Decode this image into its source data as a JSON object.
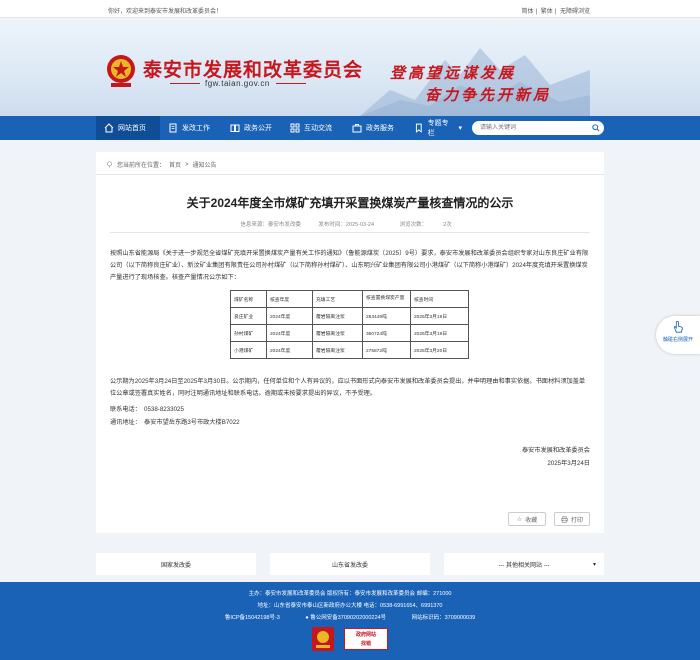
{
  "topbar": {
    "welcome": "你好，欢迎来到泰安市发展和改革委员会！",
    "links": [
      "简体",
      "繁体",
      "无障碍浏览"
    ]
  },
  "banner": {
    "title": "泰安市发展和改革委员会",
    "url": "fgw.taian.gov.cn",
    "slogan1": "登高望远谋发展",
    "slogan2": "奋力争先开新局"
  },
  "nav": {
    "items": [
      "网站首页",
      "发改工作",
      "政务公开",
      "互动交流",
      "政务服务",
      "专题专栏"
    ],
    "search_placeholder": "请输入关键词"
  },
  "breadcrumb": {
    "prefix": "您当前所在位置：",
    "home": "首页",
    "sep": ">",
    "current": "通知公告"
  },
  "article": {
    "title": "关于2024年度全市煤矿充填开采置换煤炭产量核查情况的公示",
    "source": "信息来源：泰安市发改委",
    "date": "发布时间：2025-03-24",
    "views_label": "浏览次数：",
    "views": "2次",
    "intro": "按照山东省能源局《关于进一步规范全省煤矿充填开采置换煤炭产量有关工作的通知》（鲁能源煤炭〔2025〕9号）要求，泰安市发展和改革委员会组织专家对山东良庄矿业有限公司（以下简称良庄矿业）、新汶矿业集团有限责任公司孙村煤矿（以下简称孙村煤矿）、山东明兴矿业集团有限公司小港煤矿（以下简称小港煤矿）2024年度充填开采置换煤炭产量进行了现场核查。核查产量情况公示如下：",
    "table": {
      "headers": [
        "煤矿名称",
        "核查年度",
        "充填工艺",
        "核查置换煤炭产量",
        "核查时间"
      ],
      "rows": [
        [
          "良庄矿业",
          "2024年度",
          "覆岩隔离注浆",
          "283449吨",
          "2025年3月19日"
        ],
        [
          "孙村煤矿",
          "2024年度",
          "覆岩隔离注浆",
          "360724吨",
          "2025年3月19日"
        ],
        [
          "小港煤矿",
          "2024年度",
          "覆岩隔离注浆",
          "275872吨",
          "2025年3月20日"
        ]
      ]
    },
    "notice": "公示期为2025年3月24日至2025年3月30日。公示期内，任何单位和个人有异议的，应以书面形式向泰安市发展和改革委员会提出，并申明理由和事实依据。书面材料须加盖单位公章或签署真实姓名，同时注明通讯地址和联系电话。逾期或未按要求提出的异议，不予受理。",
    "phone": "联系电话：　0538-8233025",
    "address": "通讯地址：　泰安市望岳东路3号市政大楼B7022",
    "sign_org": "泰安市发展和改革委员会",
    "sign_date": "2025年3月24日",
    "collect_label": "收藏",
    "print_label": "打印"
  },
  "footer_links": [
    "国家发改委",
    "山东省发改委",
    "--- 其他相关网站 ---"
  ],
  "footer": {
    "line1": "主办：泰安市发展和改革委员会 版权所有：泰安市发展和改革委员会 邮编：271000",
    "line2": "地址：山东省泰安市泰山区新政府办公大楼 电话：0538-6991654、6991370",
    "icp": "鲁ICP备15042198号-3",
    "police": "鲁公网安备37090202000224号",
    "site_code": "网站标识码：3709000039",
    "badge2_text": "政府网站\n找错"
  },
  "float": {
    "label": "触碰右侧展开"
  },
  "colors": {
    "brand_blue": "#1a62b6",
    "brand_red": "#c8161d"
  }
}
